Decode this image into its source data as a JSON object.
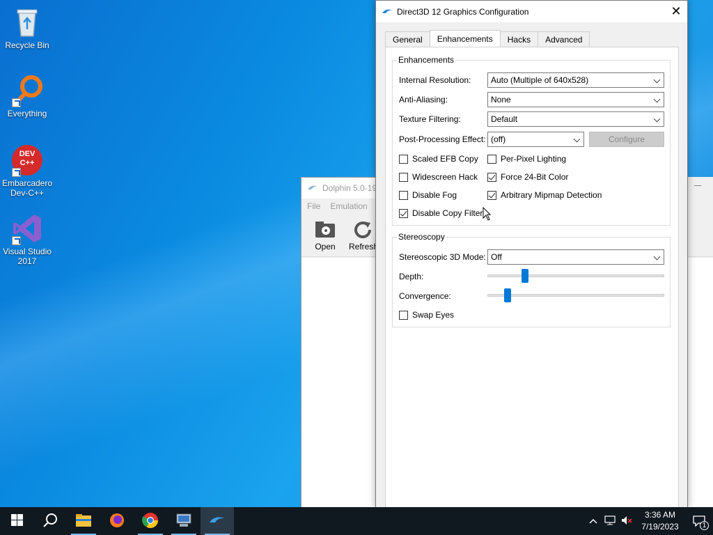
{
  "desktop": {
    "icons": [
      {
        "label": "Recycle Bin"
      },
      {
        "label": "Everything"
      },
      {
        "label": "Embarcadero Dev-C++",
        "art_text": "DEV C++"
      },
      {
        "label": "Visual Studio 2017"
      }
    ]
  },
  "dolphin": {
    "title": "Dolphin 5.0-19",
    "menu": [
      "File",
      "Emulation"
    ],
    "toolbar": {
      "open": "Open",
      "refresh": "Refresh"
    }
  },
  "dialog": {
    "title": "Direct3D 12 Graphics Configuration",
    "tabs": [
      "General",
      "Enhancements",
      "Hacks",
      "Advanced"
    ],
    "active_tab": "Enhancements",
    "enhancements": {
      "group_title": "Enhancements",
      "internal_resolution": {
        "label": "Internal Resolution:",
        "value": "Auto (Multiple of 640x528)"
      },
      "anti_aliasing": {
        "label": "Anti-Aliasing:",
        "value": "None"
      },
      "texture_filtering": {
        "label": "Texture Filtering:",
        "value": "Default"
      },
      "post_processing": {
        "label": "Post-Processing Effect:",
        "value": "(off)",
        "configure": "Configure"
      },
      "checks": {
        "scaled_efb": {
          "label": "Scaled EFB Copy",
          "checked": false
        },
        "per_pixel": {
          "label": "Per-Pixel Lighting",
          "checked": false
        },
        "widescreen": {
          "label": "Widescreen Hack",
          "checked": false
        },
        "force24": {
          "label": "Force 24-Bit Color",
          "checked": true
        },
        "disable_fog": {
          "label": "Disable Fog",
          "checked": false
        },
        "mipmap": {
          "label": "Arbitrary Mipmap Detection",
          "checked": true
        },
        "copy_filter": {
          "label": "Disable Copy Filter",
          "checked": true
        }
      }
    },
    "stereoscopy": {
      "group_title": "Stereoscopy",
      "mode": {
        "label": "Stereoscopic 3D Mode:",
        "value": "Off"
      },
      "depth": {
        "label": "Depth:",
        "level": 0.2
      },
      "convergence": {
        "label": "Convergence:",
        "level": 0.1
      },
      "swap_eyes": {
        "label": "Swap Eyes",
        "checked": false
      }
    }
  },
  "taskbar": {
    "time": "3:36 AM",
    "date": "7/19/2023",
    "notifications": "1"
  }
}
